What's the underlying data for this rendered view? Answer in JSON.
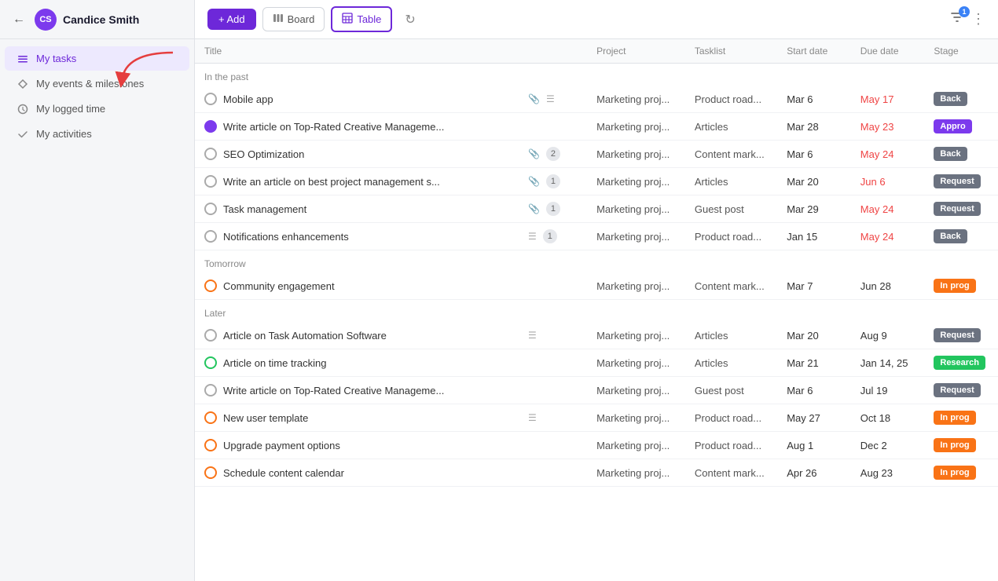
{
  "sidebar": {
    "back_icon": "←",
    "avatar_initials": "CS",
    "avatar_color": "#7c3aed",
    "user_name": "Candice Smith",
    "nav_items": [
      {
        "id": "my-tasks",
        "icon": "☰",
        "label": "My tasks",
        "active": true
      },
      {
        "id": "my-events",
        "icon": "⚑",
        "label": "My events & milestones",
        "active": false
      },
      {
        "id": "my-logged-time",
        "icon": "⏱",
        "label": "My logged time",
        "active": false
      },
      {
        "id": "my-activities",
        "icon": "✓",
        "label": "My activities",
        "active": false
      }
    ]
  },
  "toolbar": {
    "add_label": "+ Add",
    "board_label": "Board",
    "table_label": "Table",
    "filter_count": "1"
  },
  "table": {
    "columns": [
      "Title",
      "Project",
      "Tasklist",
      "Start date",
      "Due date",
      "Stage"
    ],
    "sections": [
      {
        "label": "In the past",
        "rows": [
          {
            "id": 1,
            "circle": "normal",
            "name": "Mobile app",
            "has_attach": true,
            "has_list": true,
            "count": null,
            "project": "Marketing proj...",
            "tasklist": "Product road...",
            "start": "Mar 6",
            "due": "May 17",
            "due_red": true,
            "stage": "Back",
            "stage_class": "stage-back"
          },
          {
            "id": 2,
            "circle": "purple",
            "name": "Write article on Top-Rated Creative Manageme...",
            "has_attach": false,
            "has_list": false,
            "count": null,
            "project": "Marketing proj...",
            "tasklist": "Articles",
            "start": "Mar 28",
            "due": "May 23",
            "due_red": true,
            "stage": "Appro",
            "stage_class": "stage-approve"
          },
          {
            "id": 3,
            "circle": "normal",
            "name": "SEO Optimization",
            "has_attach": true,
            "has_list": false,
            "count": "2",
            "project": "Marketing proj...",
            "tasklist": "Content mark...",
            "start": "Mar 6",
            "due": "May 24",
            "due_red": true,
            "stage": "Back",
            "stage_class": "stage-back"
          },
          {
            "id": 4,
            "circle": "normal",
            "name": "Write an article on best project management s...",
            "has_attach": true,
            "has_list": false,
            "count": "1",
            "project": "Marketing proj...",
            "tasklist": "Articles",
            "start": "Mar 20",
            "due": "Jun 6",
            "due_red": true,
            "stage": "Request",
            "stage_class": "stage-request"
          },
          {
            "id": 5,
            "circle": "normal",
            "name": "Task management",
            "has_attach": true,
            "has_list": false,
            "count": "1",
            "project": "Marketing proj...",
            "tasklist": "Guest post",
            "start": "Mar 29",
            "due": "May 24",
            "due_red": true,
            "stage": "Request",
            "stage_class": "stage-request"
          },
          {
            "id": 6,
            "circle": "normal",
            "name": "Notifications enhancements",
            "has_attach": false,
            "has_list": true,
            "count": "1",
            "project": "Marketing proj...",
            "tasklist": "Product road...",
            "start": "Jan 15",
            "due": "May 24",
            "due_red": true,
            "stage": "Back",
            "stage_class": "stage-back"
          }
        ]
      },
      {
        "label": "Tomorrow",
        "rows": [
          {
            "id": 7,
            "circle": "orange",
            "name": "Community engagement",
            "has_attach": false,
            "has_list": false,
            "count": null,
            "project": "Marketing proj...",
            "tasklist": "Content mark...",
            "start": "Mar 7",
            "due": "Jun 28",
            "due_red": false,
            "stage": "In prog",
            "stage_class": "stage-inprog"
          }
        ]
      },
      {
        "label": "Later",
        "rows": [
          {
            "id": 8,
            "circle": "normal",
            "name": "Article on Task Automation Software",
            "has_attach": false,
            "has_list": true,
            "count": null,
            "project": "Marketing proj...",
            "tasklist": "Articles",
            "start": "Mar 20",
            "due": "Aug 9",
            "due_red": false,
            "stage": "Request",
            "stage_class": "stage-request"
          },
          {
            "id": 9,
            "circle": "green",
            "name": "Article on time tracking",
            "has_attach": false,
            "has_list": false,
            "count": null,
            "project": "Marketing proj...",
            "tasklist": "Articles",
            "start": "Mar 21",
            "due": "Jan 14, 25",
            "due_red": false,
            "stage": "Research",
            "stage_class": "stage-research"
          },
          {
            "id": 10,
            "circle": "normal",
            "name": "Write article on Top-Rated Creative Manageme...",
            "has_attach": false,
            "has_list": false,
            "count": null,
            "project": "Marketing proj...",
            "tasklist": "Guest post",
            "start": "Mar 6",
            "due": "Jul 19",
            "due_red": false,
            "stage": "Request",
            "stage_class": "stage-request"
          },
          {
            "id": 11,
            "circle": "orange",
            "name": "New user template",
            "has_attach": false,
            "has_list": true,
            "count": null,
            "project": "Marketing proj...",
            "tasklist": "Product road...",
            "start": "May 27",
            "due": "Oct 18",
            "due_red": false,
            "stage": "In prog",
            "stage_class": "stage-inprog"
          },
          {
            "id": 12,
            "circle": "orange",
            "name": "Upgrade payment options",
            "has_attach": false,
            "has_list": false,
            "count": null,
            "project": "Marketing proj...",
            "tasklist": "Product road...",
            "start": "Aug 1",
            "due": "Dec 2",
            "due_red": false,
            "stage": "In prog",
            "stage_class": "stage-inprog"
          },
          {
            "id": 13,
            "circle": "orange",
            "name": "Schedule content calendar",
            "has_attach": false,
            "has_list": false,
            "count": null,
            "project": "Marketing proj...",
            "tasklist": "Content mark...",
            "start": "Apr 26",
            "due": "Aug 23",
            "due_red": false,
            "stage": "In prog",
            "stage_class": "stage-inprog"
          }
        ]
      }
    ]
  }
}
